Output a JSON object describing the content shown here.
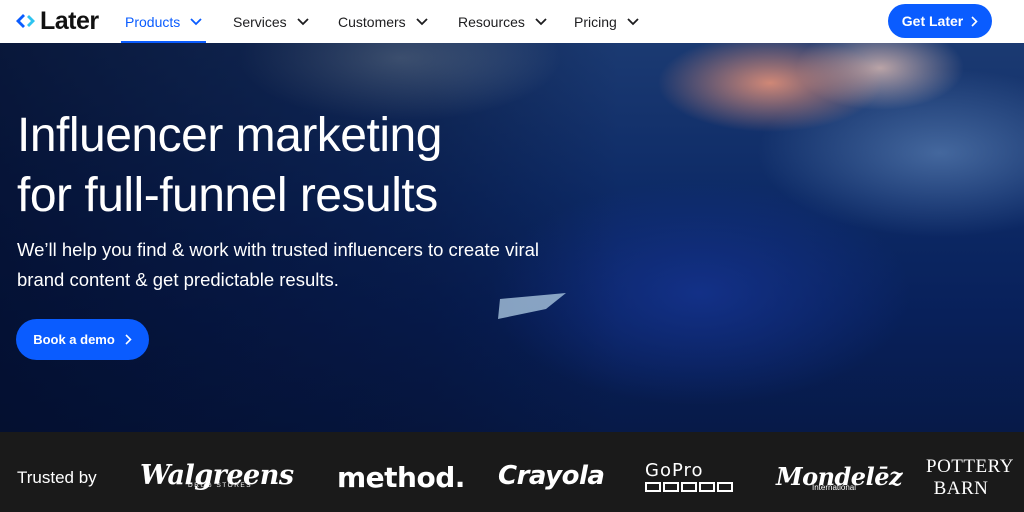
{
  "nav": {
    "logo_text": "Later",
    "items": [
      {
        "label": "Products",
        "active": true
      },
      {
        "label": "Services",
        "active": false
      },
      {
        "label": "Customers",
        "active": false
      },
      {
        "label": "Resources",
        "active": false
      },
      {
        "label": "Pricing",
        "active": false
      }
    ],
    "cta_label": "Get Later"
  },
  "hero": {
    "headline_lines": [
      "Influencer marketing",
      "for full-funnel results"
    ],
    "subhead_lines": [
      "We’ll help you find & work with trusted influencers to create viral",
      "brand content & get predictable results."
    ],
    "cta_label": "Book a demo"
  },
  "trusted": {
    "label": "Trusted by",
    "brands": {
      "walgreens": "Walgreens",
      "walgreens_sub": "DRUG STORES",
      "method": "method.",
      "crayola": "Crayola",
      "gopro": "GoPro",
      "mondelez": "Mondelēz",
      "mondelez_sub": "International",
      "pottery_barn_lines": [
        "POTTERY",
        "BARN"
      ]
    }
  },
  "colors": {
    "accent": "#0a5cff",
    "nav_text": "#1d1d1f",
    "trusted_bg": "#1a1a1a",
    "hero_dark": "#08205a"
  },
  "icons": {
    "logo": "later-logo-icon",
    "nav_chevron": "chevron-down-icon",
    "cta_arrow": "chevron-right-icon"
  }
}
